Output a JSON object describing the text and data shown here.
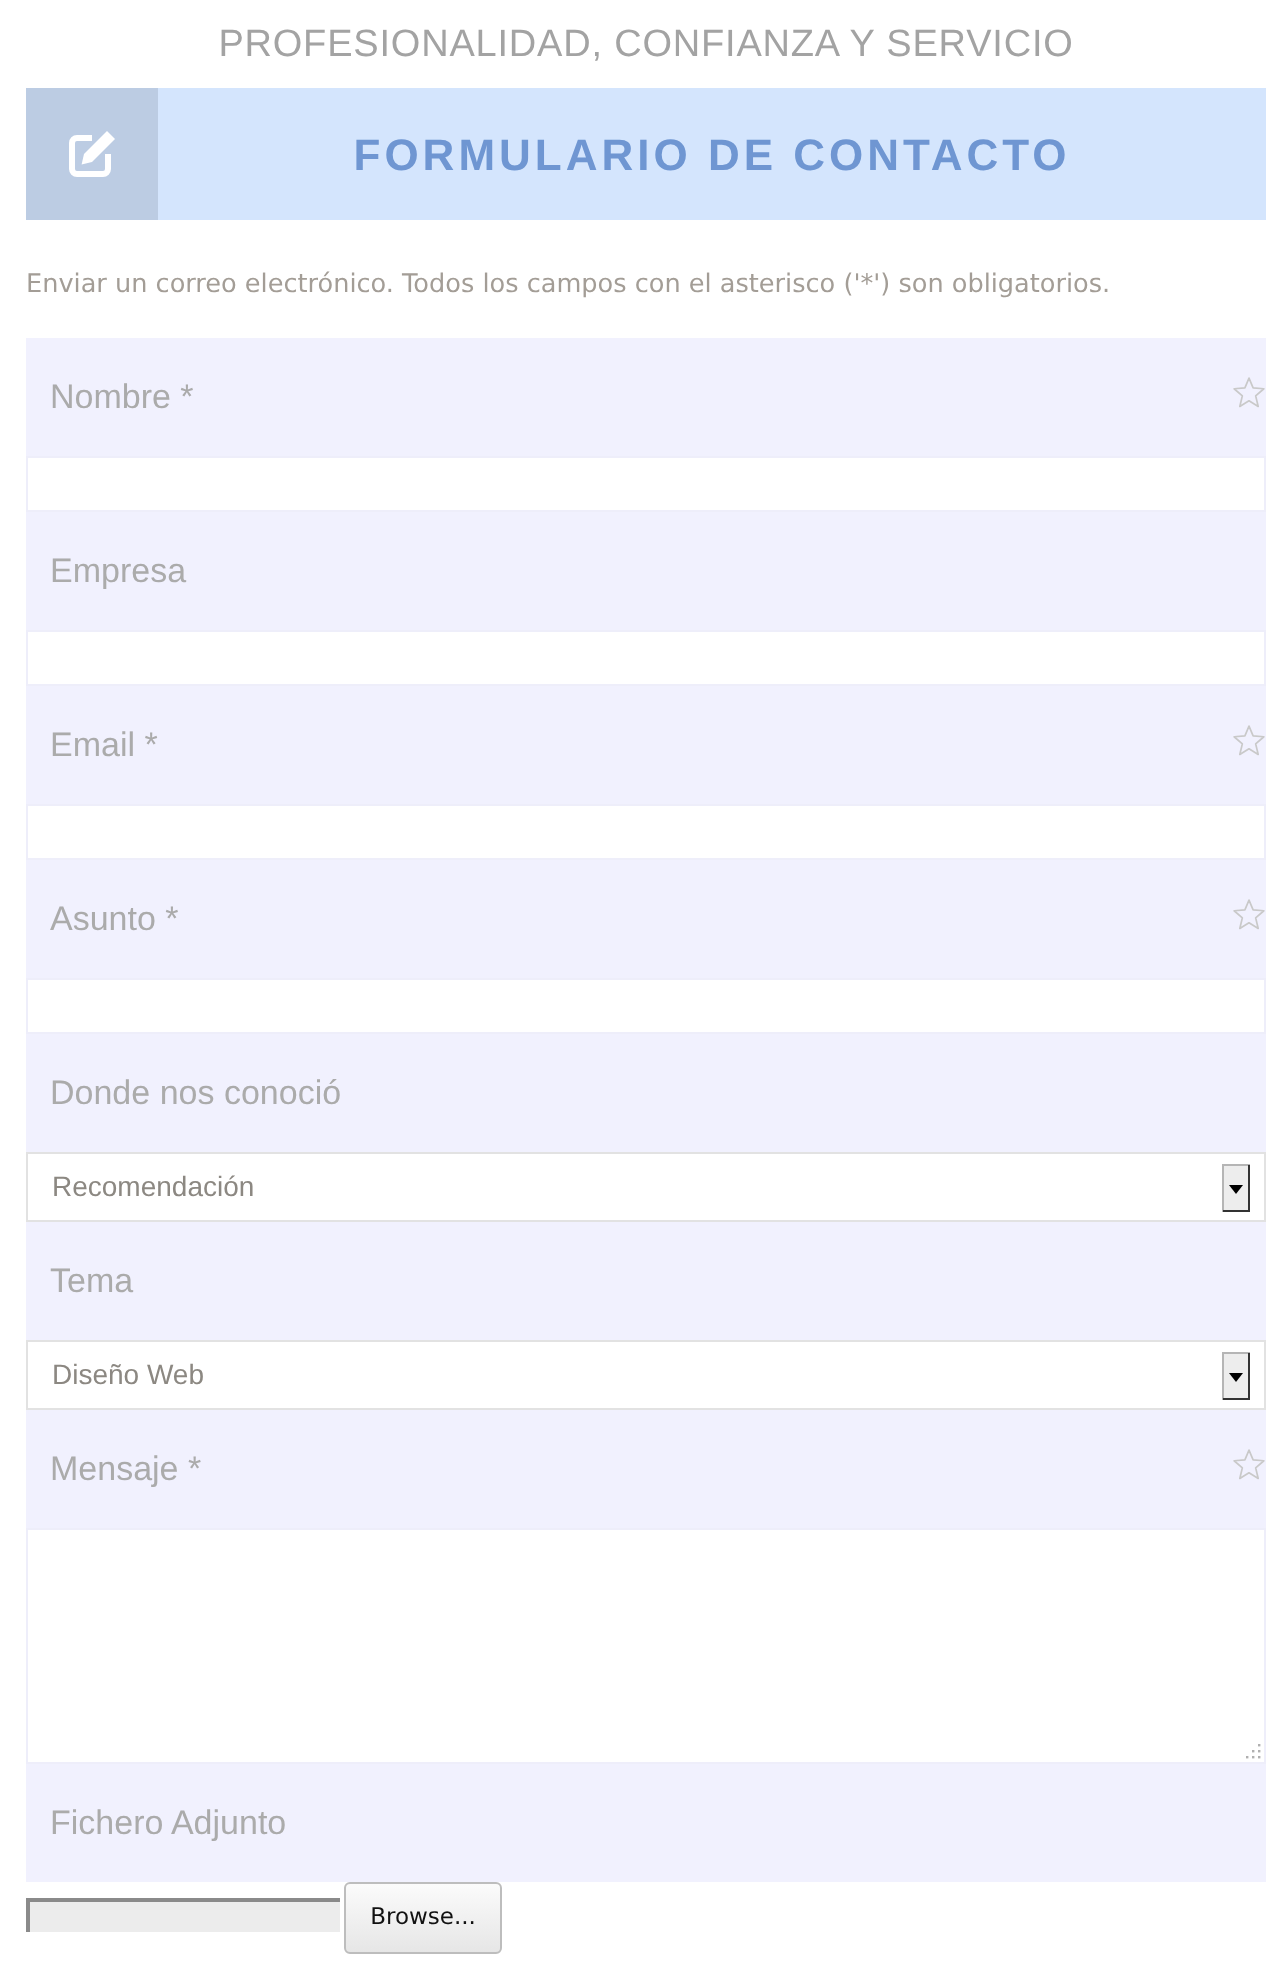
{
  "header": {
    "tagline": "PROFESIONALIDAD, CONFIANZA Y SERVICIO"
  },
  "banner": {
    "title": "FORMULARIO DE CONTACTO"
  },
  "intro": "Enviar un correo electrónico. Todos los campos con el asterisco ('*') son obligatorios.",
  "fields": [
    {
      "kind": "text",
      "label": "Nombre *",
      "required": true
    },
    {
      "kind": "text",
      "label": "Empresa",
      "required": false
    },
    {
      "kind": "text",
      "label": "Email *",
      "required": true
    },
    {
      "kind": "text",
      "label": "Asunto *",
      "required": true
    },
    {
      "kind": "select",
      "label": "Donde nos conoció",
      "required": false,
      "value": "Recomendación"
    },
    {
      "kind": "select",
      "label": "Tema",
      "required": false,
      "value": "Diseño Web"
    },
    {
      "kind": "textarea",
      "label": "Mensaje *",
      "required": true
    },
    {
      "kind": "file",
      "label": "Fichero Adjunto",
      "required": false,
      "button": "Browse..."
    }
  ]
}
